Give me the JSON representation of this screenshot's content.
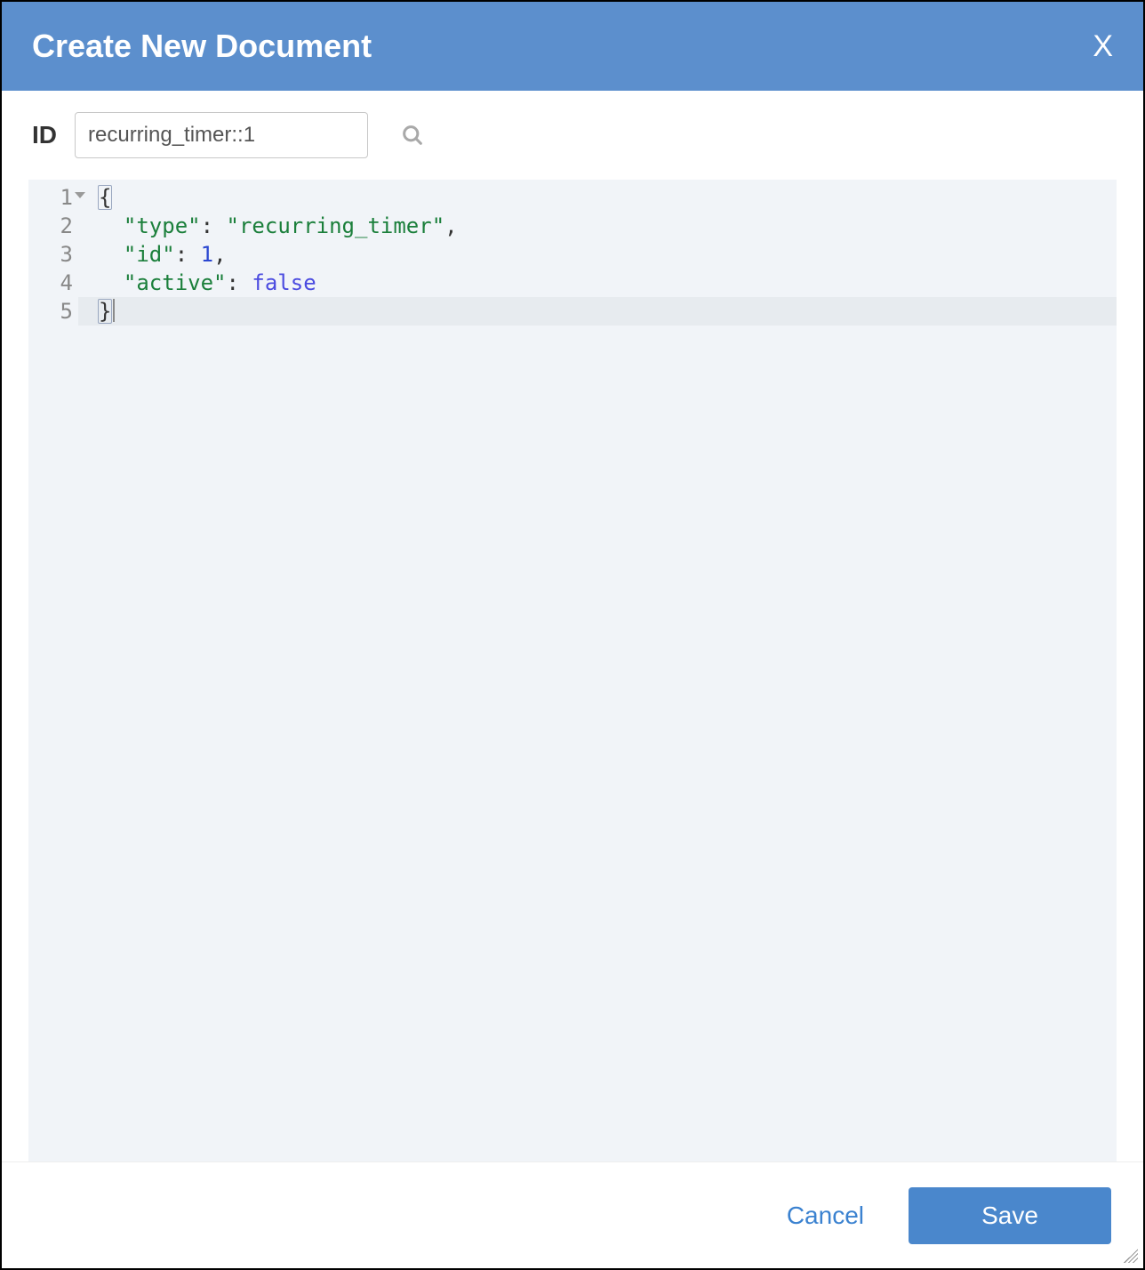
{
  "header": {
    "title": "Create New Document",
    "close_label": "X"
  },
  "id_field": {
    "label": "ID",
    "value": "recurring_timer::1"
  },
  "editor": {
    "line_numbers": [
      "1",
      "2",
      "3",
      "4",
      "5"
    ],
    "lines": [
      {
        "tokens": [
          {
            "cls": "punc bracket-hl",
            "t": "{"
          }
        ]
      },
      {
        "tokens": [
          {
            "cls": "",
            "t": "  "
          },
          {
            "cls": "str",
            "t": "\"type\""
          },
          {
            "cls": "punc",
            "t": ": "
          },
          {
            "cls": "str",
            "t": "\"recurring_timer\""
          },
          {
            "cls": "punc",
            "t": ","
          }
        ]
      },
      {
        "tokens": [
          {
            "cls": "",
            "t": "  "
          },
          {
            "cls": "str",
            "t": "\"id\""
          },
          {
            "cls": "punc",
            "t": ": "
          },
          {
            "cls": "num",
            "t": "1"
          },
          {
            "cls": "punc",
            "t": ","
          }
        ]
      },
      {
        "tokens": [
          {
            "cls": "",
            "t": "  "
          },
          {
            "cls": "str",
            "t": "\"active\""
          },
          {
            "cls": "punc",
            "t": ": "
          },
          {
            "cls": "kw",
            "t": "false"
          }
        ]
      },
      {
        "tokens": [
          {
            "cls": "punc bracket-hl",
            "t": "}"
          }
        ],
        "active": true,
        "cursor_after": true
      }
    ]
  },
  "footer": {
    "cancel_label": "Cancel",
    "save_label": "Save"
  }
}
